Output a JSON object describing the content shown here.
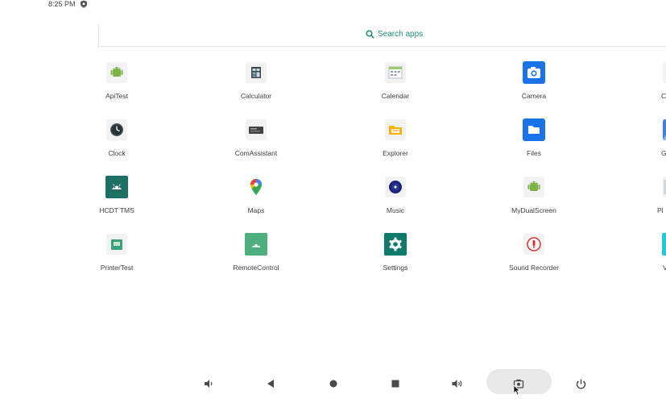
{
  "status": {
    "time": "8:25 PM",
    "icon": "shield-icon"
  },
  "search": {
    "label": "Search apps",
    "icon": "search-icon"
  },
  "apps": [
    {
      "name": "ApiTest",
      "icon": "android-robot-icon"
    },
    {
      "name": "Calculator",
      "icon": "calculator-icon"
    },
    {
      "name": "Calendar",
      "icon": "calendar-icon"
    },
    {
      "name": "Camera",
      "icon": "camera-icon"
    },
    {
      "name": "C",
      "icon": "app-icon"
    },
    {
      "name": "Clock",
      "icon": "clock-icon"
    },
    {
      "name": "ComAssistant",
      "icon": "terminal-icon"
    },
    {
      "name": "Explorer",
      "icon": "folder-icon"
    },
    {
      "name": "Files",
      "icon": "files-icon"
    },
    {
      "name": "G",
      "icon": "gallery-icon"
    },
    {
      "name": "HCDT TMS",
      "icon": "android-head-icon"
    },
    {
      "name": "Maps",
      "icon": "maps-pin-icon"
    },
    {
      "name": "Music",
      "icon": "music-disc-icon"
    },
    {
      "name": "MyDualScreen",
      "icon": "android-robot-icon"
    },
    {
      "name": "Pl",
      "icon": "app-icon"
    },
    {
      "name": "PrinterTest",
      "icon": "printer-icon"
    },
    {
      "name": "RemoteControl",
      "icon": "remote-icon"
    },
    {
      "name": "Settings",
      "icon": "gear-icon"
    },
    {
      "name": "Sound Recorder",
      "icon": "microphone-icon"
    },
    {
      "name": "V",
      "icon": "app-icon"
    }
  ],
  "navbar": {
    "buttons": [
      "volume-down-icon",
      "back-icon",
      "home-icon",
      "overview-icon",
      "volume-up-icon",
      "screenshot-icon",
      "power-icon"
    ]
  },
  "colors": {
    "accent": "#1e8e7e",
    "camera_blue": "#1a73e8",
    "settings_teal": "#0d7a6c"
  }
}
